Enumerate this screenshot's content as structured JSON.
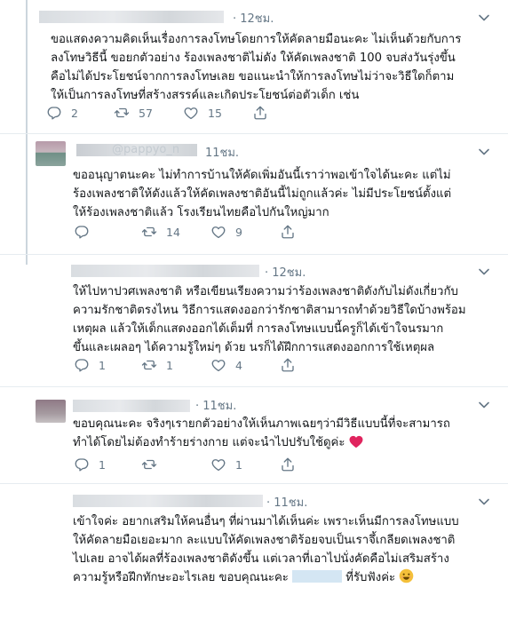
{
  "tweets": [
    {
      "time": "· 12ชม.",
      "lines": [
        "ขอแสดงความคิดเห็นเรื่องการลงโทษโดยการให้คัดลายมือนะคะ ไม่เห็นด้วยกับการ",
        "ลงโทษวิธีนี้ ขอยกตัวอย่าง ร้องเพลงชาติไม่ดัง ให้คัดเพลงชาติ 100 จบส่งวันรุ่งขึ้น",
        "คือไม่ได้ประโยชน์จากการลงโทษเลย ขอแนะนำให้การลงโทษไม่ว่าจะวิธีใดก็ตาม",
        "ให้เป็นการลงโทษที่สร้างสรรค์และเกิดประโยชน์ต่อตัวเด็ก เช่น"
      ],
      "replies": "2",
      "retweets": "57",
      "likes": "15"
    },
    {
      "handle_partial": "@pappyo_n",
      "time": "11ชม.",
      "lines": [
        "ขออนุญาตนะคะ ไม่ทำการบ้านให้คัดเพิ่มอันนี้เราว่าพอเข้าใจได้นะคะ แต่ไม่",
        "ร้องเพลงชาติให้ดังแล้วให้คัดเพลงชาติอันนี้ไม่ถูกแล้วค่ะ ไม่มีประโยชน์ตั้งแต่",
        "ให้ร้องเพลงชาติแล้ว โรงเรียนไทยคือไปกันใหญ่มาก"
      ],
      "replies": "",
      "retweets": "14",
      "likes": "9"
    },
    {
      "time": "· 12ชม.",
      "lines": [
        "ให้ไปหาปวศเพลงชาติ หรือเขียนเรียงความว่าร้องเพลงชาติดังกับไม่ดังเกี่ยวกับ",
        "ความรักชาติตรงไหน วิธีการแสดงออกว่ารักชาติสามารถทำด้วยวิธีใดบ้างพร้อม",
        "เหตุผล แล้วให้เด็กแสดงออกได้เต็มที่ การลงโทษแบบนี้ครูก็ได้เข้าใจนรมาก",
        "ขึ้นและเผลอๆ ได้ความรู้ใหม่ๆ ด้วย นรก็ได้ฝึกการแสดงออกการใช้เหตุผล"
      ],
      "replies": "1",
      "retweets": "1",
      "likes": "4"
    },
    {
      "time": "· 11ชม.",
      "lines": [
        "ขอบคุณนะคะ จริงๆเรายกตัวอย่างให้เห็นภาพเฉยๆว่ามีวิธีแบบนี้ที่จะสามารถ",
        "ทำได้โดยไม่ต้องทำร้ายร่างกาย แต่จะนำไปปรับใช้ดูค่ะ"
      ],
      "replies": "1",
      "retweets": "",
      "likes": "1"
    },
    {
      "time": "· 11ชม.",
      "lines": [
        "เข้าใจค่ะ อยากเสริมให้คนอื่นๆ ที่ผ่านมาได้เห็นค่ะ เพราะเห็นมีการลงโทษแบบ",
        "ให้คัดลายมือเยอะมาก ละแบบให้คัดเพลงชาติร้อยจบเป็นเราจึ้เกลียดเพลงชาติ",
        "ไปเลย อาจได้ผลที่ร้องเพลงชาติดังขึ้น แต่เวลาที่เอาไปนั่งคัดคือไม่เสริมสร้าง",
        "ความรู้หรือฝึกทักษะอะไรเลย ขอบคุณนะคะ"
      ],
      "last_line_tail": "ที่รับฟังค่ะ"
    }
  ],
  "colors": {
    "icon": "#657786",
    "divider": "#e6ecf0",
    "thread_line": "#ccd6dd",
    "heart_emoji": "#e0245e",
    "smile_emoji": "#f4c03a"
  },
  "icons": [
    "reply-icon",
    "retweet-icon",
    "like-icon",
    "share-icon",
    "chevron-down-icon",
    "heart-emoji-icon",
    "smile-emoji-icon"
  ]
}
